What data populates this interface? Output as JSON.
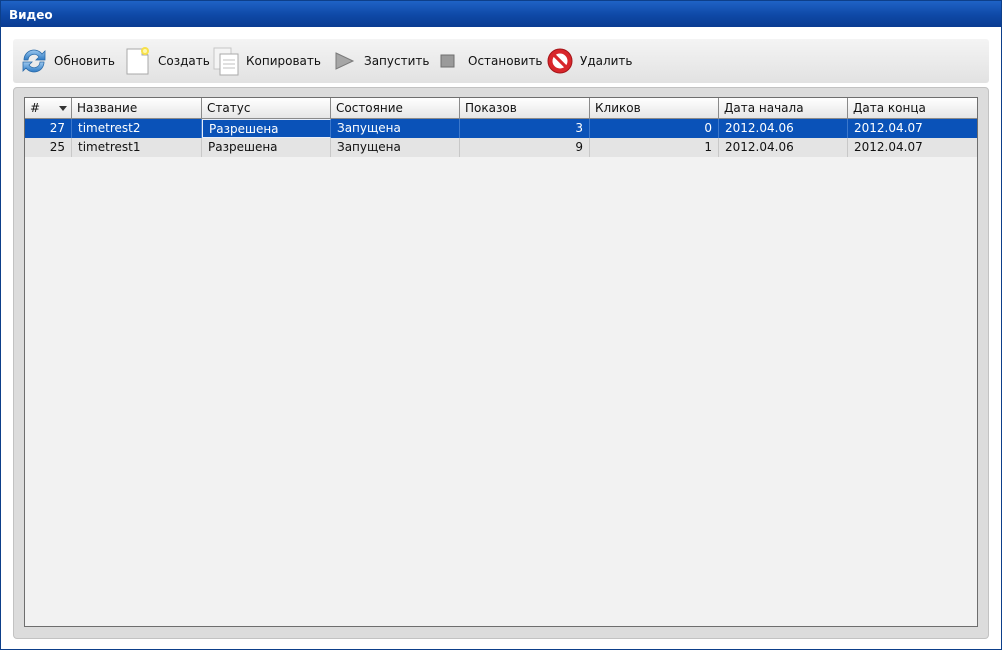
{
  "window": {
    "title": "Видео"
  },
  "toolbar": {
    "refresh": {
      "label": "Обновить",
      "icon": "refresh-icon"
    },
    "create": {
      "label": "Создать",
      "icon": "new-document-icon"
    },
    "copy": {
      "label": "Копировать",
      "icon": "copy-icon"
    },
    "start": {
      "label": "Запустить",
      "icon": "play-icon"
    },
    "stop": {
      "label": "Остановить",
      "icon": "stop-icon"
    },
    "delete": {
      "label": "Удалить",
      "icon": "delete-icon"
    }
  },
  "table": {
    "columns": [
      "#",
      "Название",
      "Статус",
      "Состояние",
      "Показов",
      "Кликов",
      "Дата начала",
      "Дата конца"
    ],
    "sort_column": "#",
    "sort_direction": "descending",
    "rows": [
      {
        "id": "27",
        "name": "timetrest2",
        "status": "Разрешена",
        "state": "Запущена",
        "views": "3",
        "clicks": "0",
        "start": "2012.04.06",
        "end": "2012.04.07",
        "selected": true
      },
      {
        "id": "25",
        "name": "timetrest1",
        "status": "Разрешена",
        "state": "Запущена",
        "views": "9",
        "clicks": "1",
        "start": "2012.04.06",
        "end": "2012.04.07",
        "selected": false
      }
    ]
  },
  "colors": {
    "titlebar": "#0e48a6",
    "selection": "#0a52b8"
  }
}
